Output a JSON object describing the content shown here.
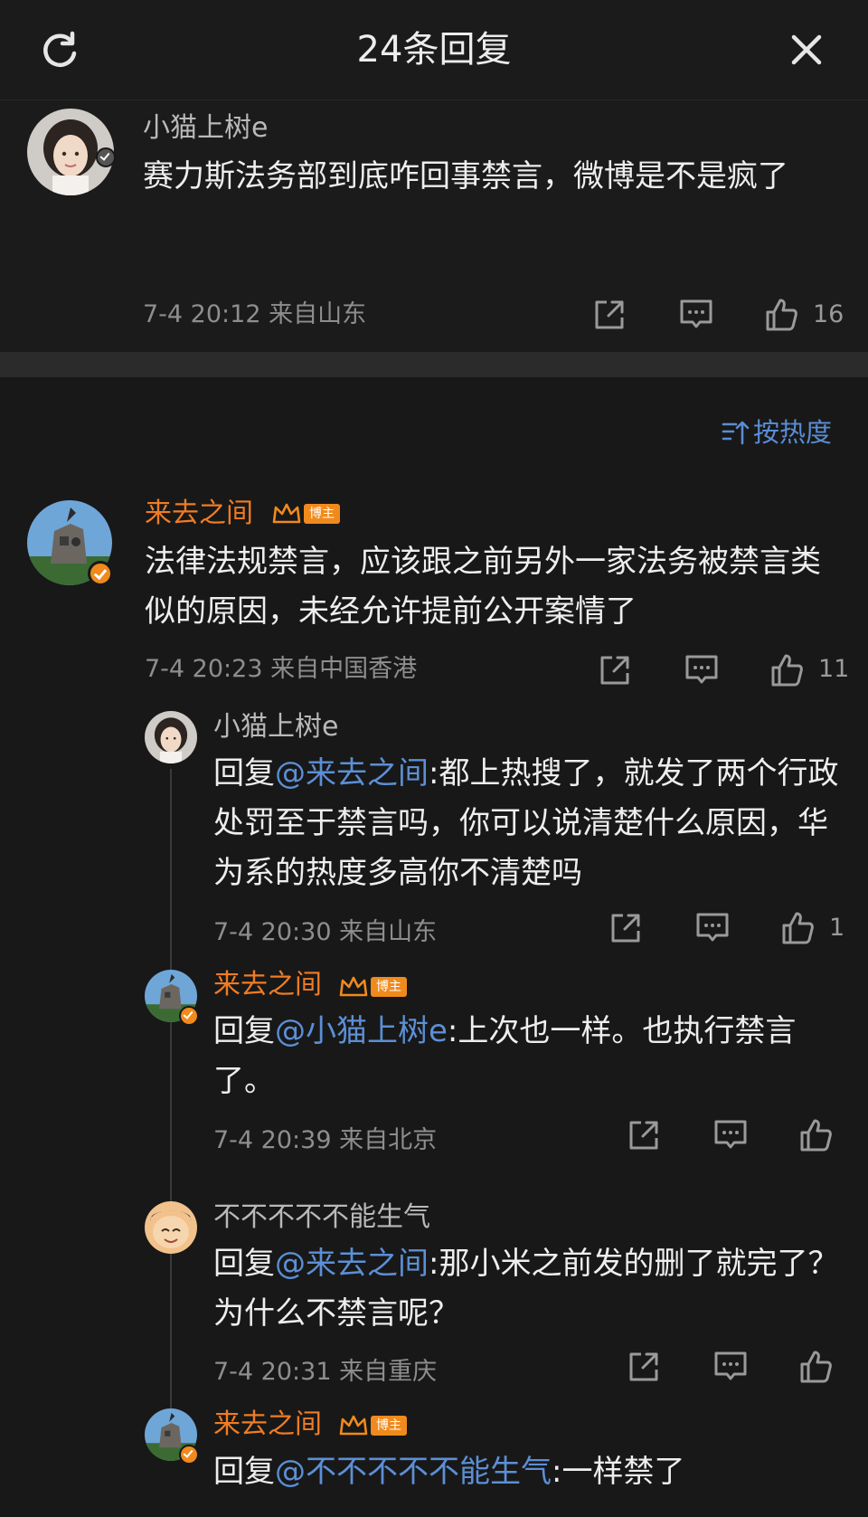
{
  "header": {
    "title": "24条回复"
  },
  "root_comment": {
    "username": "小猫上树e",
    "text": "赛力斯法务部到底咋回事禁言，微博是不是疯了",
    "meta": "7-4 20:12 来自山东",
    "likes": "16"
  },
  "sort": {
    "label": "按热度"
  },
  "comments": [
    {
      "username": "来去之间",
      "badge": "博主",
      "text": "法律法规禁言，应该跟之前另外一家法务被禁言类似的原因，未经允许提前公开案情了",
      "meta": "7-4 20:23 来自中国香港",
      "likes": "11"
    },
    {
      "username": "小猫上树e",
      "reply_prefix": "回复",
      "mention": "@来去之间",
      "text": ":都上热搜了，就发了两个行政处罚至于禁言吗，你可以说清楚什么原因，华为系的热度多高你不清楚吗",
      "meta": "7-4 20:30 来自山东",
      "likes": "1"
    },
    {
      "username": "来去之间",
      "badge": "博主",
      "reply_prefix": "回复",
      "mention": "@小猫上树e",
      "text": ":上次也一样。也执行禁言了。",
      "meta": "7-4 20:39 来自北京"
    },
    {
      "username": "不不不不不能生气",
      "reply_prefix": "回复",
      "mention": "@来去之间",
      "text": ":那小米之前发的删了就完了？为什么不禁言呢？",
      "meta": "7-4 20:31 来自重庆"
    },
    {
      "username": "来去之间",
      "badge": "博主",
      "reply_prefix": "回复",
      "mention": "@不不不不不能生气",
      "text": ":一样禁了"
    }
  ],
  "icons": {
    "refresh": "refresh-icon",
    "close": "close-icon",
    "share": "share-icon",
    "comment": "comment-icon",
    "like": "thumbs-up-icon",
    "sort": "sort-icon",
    "verified": "verified-v-icon",
    "crown": "crown-icon"
  },
  "colors": {
    "background": "#181818",
    "username_highlight": "#f07c24",
    "mention": "#5c8fd6",
    "badge": "#f08a1c"
  }
}
